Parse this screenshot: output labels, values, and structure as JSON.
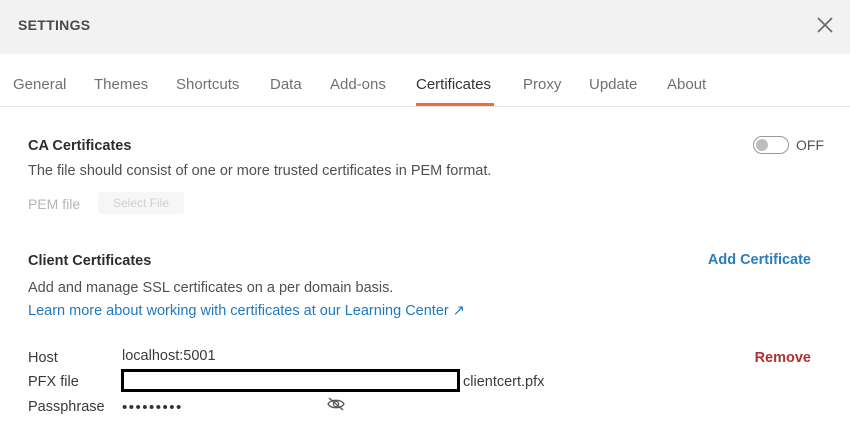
{
  "header": {
    "title": "SETTINGS",
    "close_icon": "close-icon"
  },
  "tabs": [
    {
      "label": "General"
    },
    {
      "label": "Themes"
    },
    {
      "label": "Shortcuts"
    },
    {
      "label": "Data"
    },
    {
      "label": "Add-ons"
    },
    {
      "label": "Certificates",
      "active": true
    },
    {
      "label": "Proxy"
    },
    {
      "label": "Update"
    },
    {
      "label": "About"
    }
  ],
  "colors": {
    "accent": "#f26b3a",
    "link": "#1f79c0",
    "danger": "#b03030"
  },
  "ca": {
    "title": "CA Certificates",
    "description": "The file should consist of one or more trusted certificates in PEM format.",
    "toggle_state": "OFF",
    "pem_label": "PEM file",
    "select_file_label": "Select File"
  },
  "client": {
    "title": "Client Certificates",
    "add_label": "Add Certificate",
    "description": "Add and manage SSL certificates on a per domain basis.",
    "learn_more": "Learn more about working with certificates at our Learning Center ↗",
    "certificate": {
      "host_label": "Host",
      "host_value": "localhost:5001",
      "pfx_label": "PFX file",
      "pfx_value": "clientcert.pfx",
      "passphrase_label": "Passphrase",
      "passphrase_value": "•••••••••",
      "remove_label": "Remove",
      "visibility_icon": "eye-off-icon"
    }
  }
}
